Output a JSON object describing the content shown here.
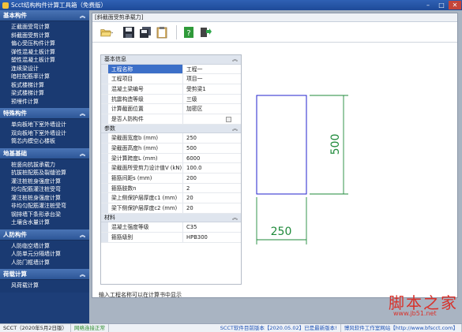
{
  "window": {
    "title": "Scct结构构件计算工具箱（免费版）",
    "min": "–",
    "max": "□",
    "close": "✕"
  },
  "sidebar": {
    "sections": [
      {
        "label": "基本构件",
        "items": [
          "正截面受弯计算",
          "斜截面受剪计算",
          "偏心受压构件计算",
          "弹性混凝土板计算",
          "塑性混凝土板计算",
          "连续梁设计",
          "暗柱配筋率计算",
          "板式楼梯计算",
          "梁式楼梯计算",
          "预埋件计算"
        ]
      },
      {
        "label": "特殊构件",
        "items": [
          "单向板地下室外墙设计",
          "双向板地下室外墙设计",
          "筒芯内模空心楼板"
        ]
      },
      {
        "label": "地基基础",
        "items": [
          "桩竖向抗拔承载力",
          "抗拔桩配筋及裂缝验算",
          "灌注桩桩身强度计算",
          "均匀配筋灌注桩受弯",
          "灌注桩桩身强度计算",
          "非均匀配筋灌注桩受弯",
          "钢排墙下条形承台梁",
          "土壤含水量计算"
        ]
      },
      {
        "label": "人防构件",
        "items": [
          "人防临空墙计算",
          "人防单元分隔墙计算",
          "人防门框墙计算"
        ]
      },
      {
        "label": "荷载计算",
        "items": [
          "风荷载计算"
        ]
      }
    ]
  },
  "doc": {
    "title": "[斜截面受剪承载力]",
    "hint": "输入工程名称可以在计算书中显示"
  },
  "grid": {
    "basic": {
      "category": "基本信息",
      "rows": [
        {
          "name": "工程名称",
          "value": "工程一"
        },
        {
          "name": "工程项目",
          "value": "项目一"
        },
        {
          "name": "混凝土梁编号",
          "value": "受剪梁1"
        },
        {
          "name": "抗震构造等级",
          "value": "三级"
        },
        {
          "name": "计算截面位置",
          "value": "加密区"
        },
        {
          "name": "是否人防构件",
          "value": ""
        }
      ]
    },
    "params": {
      "category": "参数",
      "rows": [
        {
          "name": "梁截面宽度b (mm)",
          "value": "250"
        },
        {
          "name": "梁截面高度h (mm)",
          "value": "500"
        },
        {
          "name": "梁计算跨度L (mm)",
          "value": "6000"
        },
        {
          "name": "梁截面所受剪力设计值V (kN)",
          "value": "100.0"
        },
        {
          "name": "箍筋间距s (mm)",
          "value": "200"
        },
        {
          "name": "箍筋肢数n",
          "value": "2"
        },
        {
          "name": "梁上侧保护层厚度c1 (mm)",
          "value": "20"
        },
        {
          "name": "梁下侧保护层厚度c2 (mm)",
          "value": "20"
        }
      ]
    },
    "material": {
      "category": "材料",
      "rows": [
        {
          "name": "混凝土强度等级",
          "value": "C35"
        },
        {
          "name": "箍筋级别",
          "value": "HPB300"
        }
      ]
    },
    "fold_glyph": "︽"
  },
  "drawing": {
    "height_label": "500",
    "width_label": "250",
    "colors": {
      "section": "#2222cc",
      "dimension": "#1f8a3a"
    }
  },
  "watermark": {
    "text": "脚本之家",
    "url": "www.jb51.net"
  },
  "status": {
    "version": "SCCT（2020年5月2日版）",
    "network": "网络连接正常",
    "update": "SCCT软件目前版本【2020.05.02】已是最新版本!",
    "website": "博风软件工作室网站【http://www.bfscct.com】"
  }
}
